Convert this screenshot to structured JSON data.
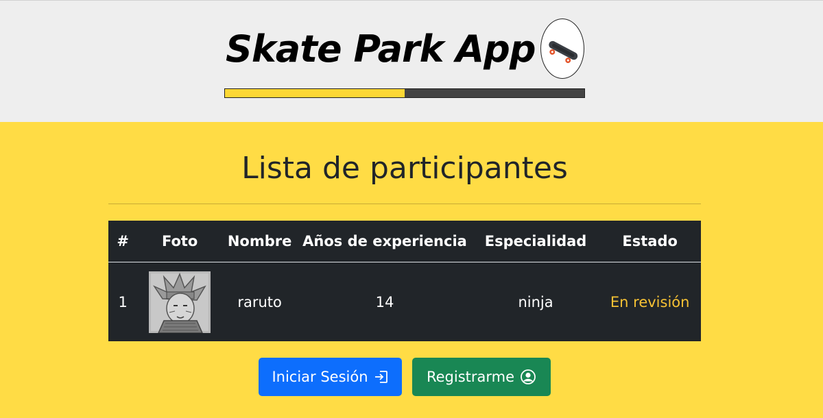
{
  "header": {
    "title": "Skate Park App",
    "logo_icon": "skateboard-icon",
    "progress": 0.5,
    "progress_color": "#fdd835",
    "progress_track_color": "#444444"
  },
  "main": {
    "title": "Lista de participantes"
  },
  "table": {
    "columns": [
      "#",
      "Foto",
      "Nombre",
      "Años de experiencia",
      "Especialidad",
      "Estado"
    ],
    "rows": [
      {
        "num": "1",
        "photo_icon": "participant-photo",
        "nombre": "raruto",
        "anos": "14",
        "especialidad": "ninja",
        "estado": "En revisión"
      }
    ]
  },
  "buttons": {
    "login_label": "Iniciar Sesión",
    "login_icon": "login-icon",
    "register_label": "Registrarme",
    "register_icon": "user-circle-icon"
  },
  "colors": {
    "page_background": "#ffdc45",
    "header_background": "#eeeeee",
    "table_background": "#212529",
    "status_pending": "#f7c234",
    "login_button": "#0d6efd",
    "register_button": "#198754"
  }
}
